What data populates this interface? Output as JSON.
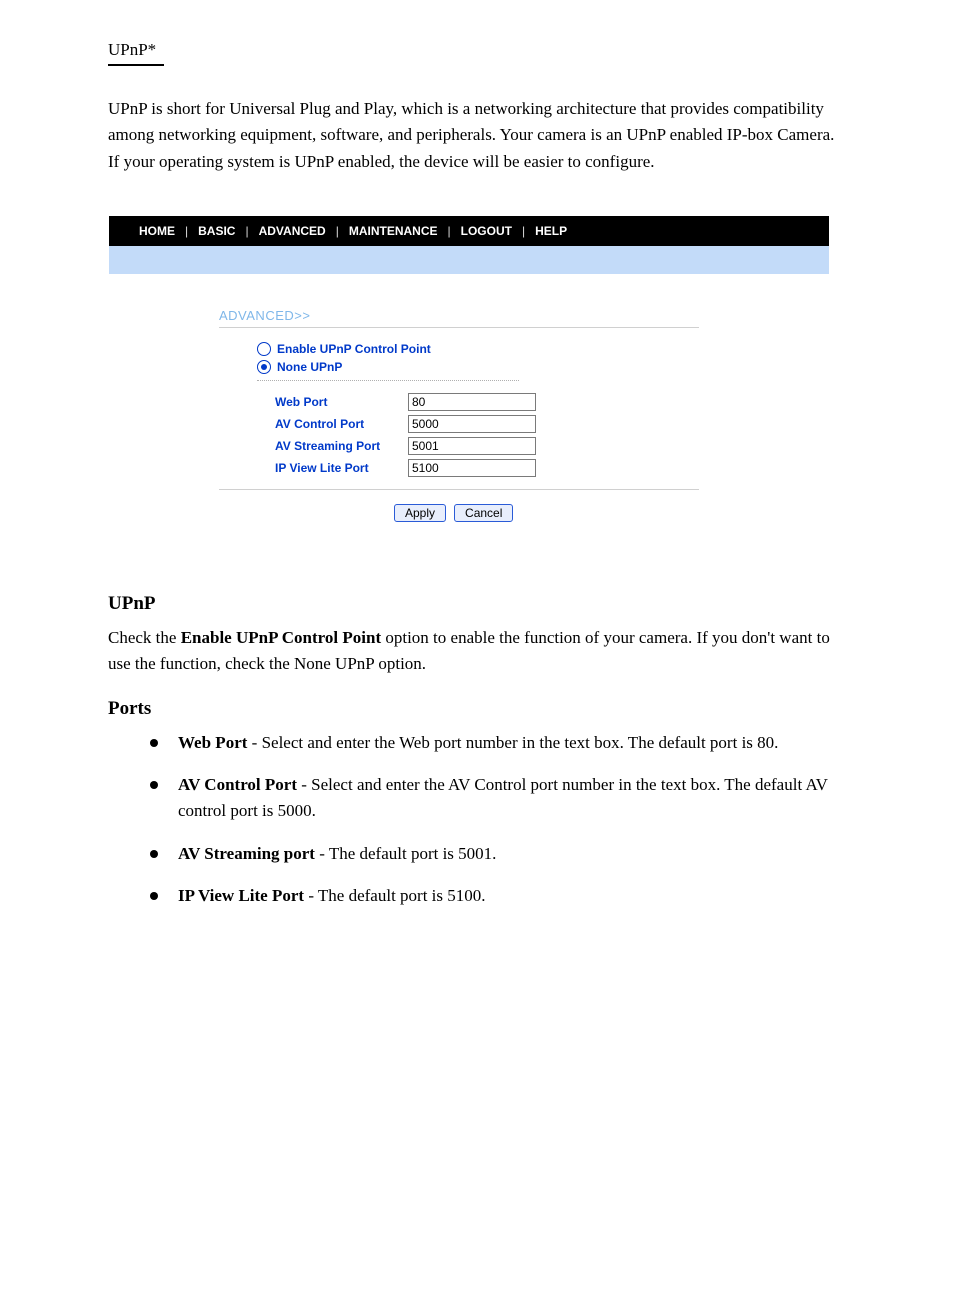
{
  "breadcrumb": "UPnP*",
  "intro": "UPnP is short for Universal Plug and Play, which is a networking architecture that provides compatibility among networking equipment, software, and peripherals. Your camera is an UPnP enabled IP-box Camera. If your operating system is UPnP enabled, the device will be easier to configure.",
  "nav": {
    "home": "HOME",
    "basic": "BASIC",
    "advanced": "ADVANCED",
    "maintenance": "MAINTENANCE",
    "logout": "LOGOUT",
    "help": "HELP",
    "sep": "|"
  },
  "config": {
    "section": "ADVANCED>>",
    "radio_enable": "Enable UPnP Control Point",
    "radio_none": "None UPnP",
    "labels": {
      "web": "Web Port",
      "avc": "AV Control Port",
      "avs": "AV Streaming Port",
      "ipv": "IP View Lite Port"
    },
    "values": {
      "web": "80",
      "avc": "5000",
      "avs": "5001",
      "ipv": "5100"
    },
    "apply": "Apply",
    "cancel": "Cancel"
  },
  "upnp_heading": "UPnP",
  "upnp_desc_prefix": "Check the ",
  "upnp_desc_bold": "Enable UPnP Control Point",
  "upnp_desc_suffix": " option to enable the function of your camera. If you don't want to use the function, check the None UPnP option.",
  "ports_heading": "Ports",
  "bullets": {
    "b1_bold": "Web Port",
    "b1_txt": " - Select and enter the Web port number in the text box. The default port is 80.",
    "b2_bold": "AV Control Port",
    "b2_txt": " - Select and enter the AV Control port number in the text box. The default AV control port is 5000.",
    "b3_bold": "AV Streaming port",
    "b3_txt": " - The default port is 5001.",
    "b4_bold": "IP View Lite Port",
    "b4_txt": " - The default port is 5100."
  }
}
